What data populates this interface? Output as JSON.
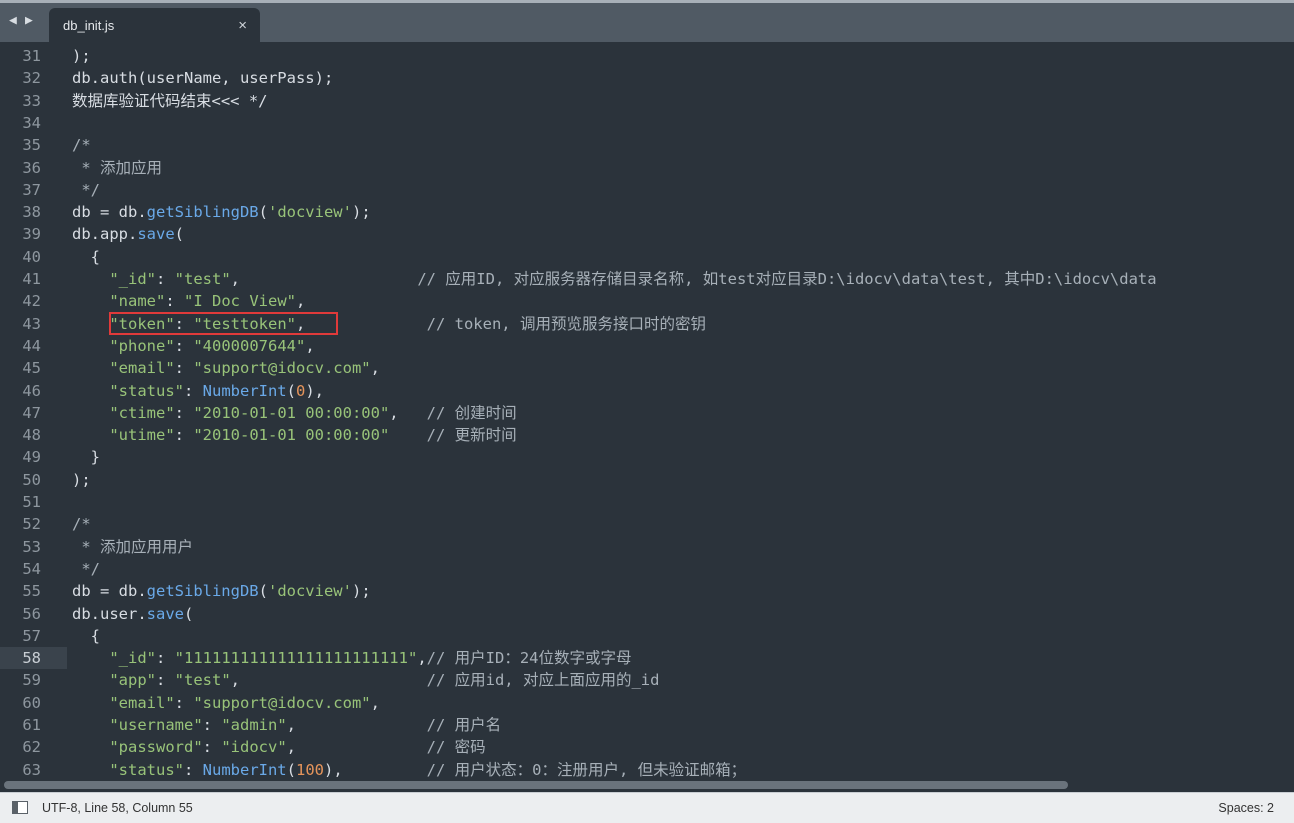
{
  "tabbar": {
    "nav_back": "◀",
    "nav_forward": "▶",
    "active_tab": {
      "title": "db_init.js",
      "close": "×"
    }
  },
  "editor": {
    "current_line": 58,
    "highlighted_line": 43,
    "lines": [
      {
        "n": "31",
        "tokens": [
          {
            "t": "text",
            "v": ");"
          }
        ]
      },
      {
        "n": "32",
        "tokens": [
          {
            "t": "text",
            "v": "db.auth(userName, userPass);"
          }
        ]
      },
      {
        "n": "33",
        "tokens": [
          {
            "t": "text",
            "v": "数据库验证代码结束<<< */"
          }
        ]
      },
      {
        "n": "34",
        "tokens": []
      },
      {
        "n": "35",
        "tokens": [
          {
            "t": "comment",
            "v": "/*"
          }
        ]
      },
      {
        "n": "36",
        "tokens": [
          {
            "t": "comment",
            "v": " * 添加应用"
          }
        ]
      },
      {
        "n": "37",
        "tokens": [
          {
            "t": "comment",
            "v": " */"
          }
        ]
      },
      {
        "n": "38",
        "tokens": [
          {
            "t": "text",
            "v": "db = db."
          },
          {
            "t": "func",
            "v": "getSiblingDB"
          },
          {
            "t": "text",
            "v": "("
          },
          {
            "t": "string",
            "v": "'docview'"
          },
          {
            "t": "text",
            "v": ");"
          }
        ]
      },
      {
        "n": "39",
        "tokens": [
          {
            "t": "text",
            "v": "db.app."
          },
          {
            "t": "func",
            "v": "save"
          },
          {
            "t": "text",
            "v": "("
          }
        ]
      },
      {
        "n": "40",
        "tokens": [
          {
            "t": "text",
            "v": "  {"
          }
        ]
      },
      {
        "n": "41",
        "tokens": [
          {
            "t": "text",
            "v": "    "
          },
          {
            "t": "string",
            "v": "\"_id\""
          },
          {
            "t": "text",
            "v": ": "
          },
          {
            "t": "string",
            "v": "\"test\""
          },
          {
            "t": "text",
            "v": ",                   "
          },
          {
            "t": "comment",
            "v": "// 应用ID, 对应服务器存储目录名称, 如test对应目录D:\\idocv\\data\\test, 其中D:\\idocv\\data"
          }
        ]
      },
      {
        "n": "42",
        "tokens": [
          {
            "t": "text",
            "v": "    "
          },
          {
            "t": "string",
            "v": "\"name\""
          },
          {
            "t": "text",
            "v": ": "
          },
          {
            "t": "string",
            "v": "\"I Doc View\""
          },
          {
            "t": "text",
            "v": ","
          }
        ]
      },
      {
        "n": "43",
        "tokens": [
          {
            "t": "text",
            "v": "    "
          },
          {
            "t": "string",
            "v": "\"token\""
          },
          {
            "t": "text",
            "v": ": "
          },
          {
            "t": "string",
            "v": "\"testtoken\""
          },
          {
            "t": "text",
            "v": ",             "
          },
          {
            "t": "comment",
            "v": "// token, 调用预览服务接口时的密钥"
          }
        ]
      },
      {
        "n": "44",
        "tokens": [
          {
            "t": "text",
            "v": "    "
          },
          {
            "t": "string",
            "v": "\"phone\""
          },
          {
            "t": "text",
            "v": ": "
          },
          {
            "t": "string",
            "v": "\"4000007644\""
          },
          {
            "t": "text",
            "v": ","
          }
        ]
      },
      {
        "n": "45",
        "tokens": [
          {
            "t": "text",
            "v": "    "
          },
          {
            "t": "string",
            "v": "\"email\""
          },
          {
            "t": "text",
            "v": ": "
          },
          {
            "t": "string",
            "v": "\"support@idocv.com\""
          },
          {
            "t": "text",
            "v": ","
          }
        ]
      },
      {
        "n": "46",
        "tokens": [
          {
            "t": "text",
            "v": "    "
          },
          {
            "t": "string",
            "v": "\"status\""
          },
          {
            "t": "text",
            "v": ": "
          },
          {
            "t": "func",
            "v": "NumberInt"
          },
          {
            "t": "text",
            "v": "("
          },
          {
            "t": "number",
            "v": "0"
          },
          {
            "t": "text",
            "v": "),"
          }
        ]
      },
      {
        "n": "47",
        "tokens": [
          {
            "t": "text",
            "v": "    "
          },
          {
            "t": "string",
            "v": "\"ctime\""
          },
          {
            "t": "text",
            "v": ": "
          },
          {
            "t": "string",
            "v": "\"2010-01-01 00:00:00\""
          },
          {
            "t": "text",
            "v": ",   "
          },
          {
            "t": "comment",
            "v": "// 创建时间"
          }
        ]
      },
      {
        "n": "48",
        "tokens": [
          {
            "t": "text",
            "v": "    "
          },
          {
            "t": "string",
            "v": "\"utime\""
          },
          {
            "t": "text",
            "v": ": "
          },
          {
            "t": "string",
            "v": "\"2010-01-01 00:00:00\""
          },
          {
            "t": "text",
            "v": "    "
          },
          {
            "t": "comment",
            "v": "// 更新时间"
          }
        ]
      },
      {
        "n": "49",
        "tokens": [
          {
            "t": "text",
            "v": "  }"
          }
        ]
      },
      {
        "n": "50",
        "tokens": [
          {
            "t": "text",
            "v": ");"
          }
        ]
      },
      {
        "n": "51",
        "tokens": []
      },
      {
        "n": "52",
        "tokens": [
          {
            "t": "comment",
            "v": "/*"
          }
        ]
      },
      {
        "n": "53",
        "tokens": [
          {
            "t": "comment",
            "v": " * 添加应用用户"
          }
        ]
      },
      {
        "n": "54",
        "tokens": [
          {
            "t": "comment",
            "v": " */"
          }
        ]
      },
      {
        "n": "55",
        "tokens": [
          {
            "t": "text",
            "v": "db = db."
          },
          {
            "t": "func",
            "v": "getSiblingDB"
          },
          {
            "t": "text",
            "v": "("
          },
          {
            "t": "string",
            "v": "'docview'"
          },
          {
            "t": "text",
            "v": ");"
          }
        ]
      },
      {
        "n": "56",
        "tokens": [
          {
            "t": "text",
            "v": "db.user."
          },
          {
            "t": "func",
            "v": "save"
          },
          {
            "t": "text",
            "v": "("
          }
        ]
      },
      {
        "n": "57",
        "tokens": [
          {
            "t": "text",
            "v": "  {"
          }
        ]
      },
      {
        "n": "58",
        "tokens": [
          {
            "t": "text",
            "v": "    "
          },
          {
            "t": "string",
            "v": "\"_id\""
          },
          {
            "t": "text",
            "v": ": "
          },
          {
            "t": "string",
            "v": "\"111111111111111111111111\""
          },
          {
            "t": "text",
            "v": ","
          },
          {
            "t": "comment",
            "v": "// 用户ID：24位数字或字母"
          }
        ]
      },
      {
        "n": "59",
        "tokens": [
          {
            "t": "text",
            "v": "    "
          },
          {
            "t": "string",
            "v": "\"app\""
          },
          {
            "t": "text",
            "v": ": "
          },
          {
            "t": "string",
            "v": "\"test\""
          },
          {
            "t": "text",
            "v": ",                    "
          },
          {
            "t": "comment",
            "v": "// 应用id, 对应上面应用的_id"
          }
        ]
      },
      {
        "n": "60",
        "tokens": [
          {
            "t": "text",
            "v": "    "
          },
          {
            "t": "string",
            "v": "\"email\""
          },
          {
            "t": "text",
            "v": ": "
          },
          {
            "t": "string",
            "v": "\"support@idocv.com\""
          },
          {
            "t": "text",
            "v": ","
          }
        ]
      },
      {
        "n": "61",
        "tokens": [
          {
            "t": "text",
            "v": "    "
          },
          {
            "t": "string",
            "v": "\"username\""
          },
          {
            "t": "text",
            "v": ": "
          },
          {
            "t": "string",
            "v": "\"admin\""
          },
          {
            "t": "text",
            "v": ",              "
          },
          {
            "t": "comment",
            "v": "// 用户名"
          }
        ]
      },
      {
        "n": "62",
        "tokens": [
          {
            "t": "text",
            "v": "    "
          },
          {
            "t": "string",
            "v": "\"password\""
          },
          {
            "t": "text",
            "v": ": "
          },
          {
            "t": "string",
            "v": "\"idocv\""
          },
          {
            "t": "text",
            "v": ",              "
          },
          {
            "t": "comment",
            "v": "// 密码"
          }
        ]
      },
      {
        "n": "63",
        "tokens": [
          {
            "t": "text",
            "v": "    "
          },
          {
            "t": "string",
            "v": "\"status\""
          },
          {
            "t": "text",
            "v": ": "
          },
          {
            "t": "func",
            "v": "NumberInt"
          },
          {
            "t": "text",
            "v": "("
          },
          {
            "t": "number",
            "v": "100"
          },
          {
            "t": "text",
            "v": "),         "
          },
          {
            "t": "comment",
            "v": "// 用户状态：0：注册用户, 但未验证邮箱；"
          }
        ]
      }
    ]
  },
  "statusbar": {
    "left": "UTF-8, Line 58, Column 55",
    "right": "Spaces: 2"
  },
  "colors": {
    "background": "#2b333b",
    "string": "#98c379",
    "function": "#6aa9e8",
    "number": "#e5945b",
    "highlight_box": "#e03a3a"
  }
}
